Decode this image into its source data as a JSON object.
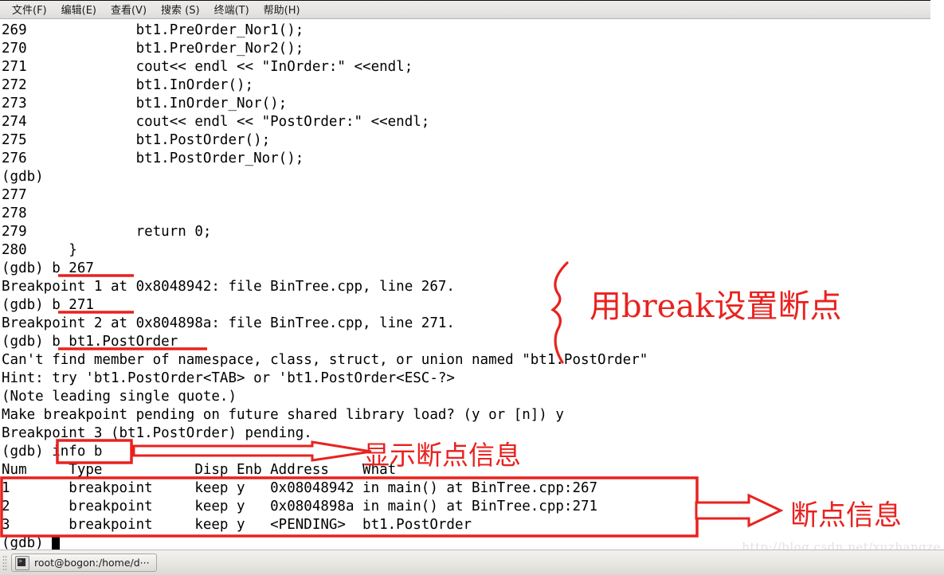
{
  "menubar": {
    "items": [
      {
        "label": "文件(F)",
        "name": "menu-file"
      },
      {
        "label": "编辑(E)",
        "name": "menu-edit"
      },
      {
        "label": "查看(V)",
        "name": "menu-view"
      },
      {
        "label": "搜索 (S)",
        "name": "menu-search"
      },
      {
        "label": "终端(T)",
        "name": "menu-terminal"
      },
      {
        "label": "帮助(H)",
        "name": "menu-help"
      }
    ]
  },
  "terminal": {
    "lines": [
      "269             bt1.PreOrder_Nor1();",
      "270             bt1.PreOrder_Nor2();",
      "271             cout<< endl << \"InOrder:\" <<endl;",
      "272             bt1.InOrder();",
      "273             bt1.InOrder_Nor();",
      "274             cout<< endl << \"PostOrder:\" <<endl;",
      "275             bt1.PostOrder();",
      "276             bt1.PostOrder_Nor();",
      "(gdb) ",
      "277",
      "278",
      "279             return 0;",
      "280     }",
      "(gdb) b 267",
      "Breakpoint 1 at 0x8048942: file BinTree.cpp, line 267.",
      "(gdb) b 271",
      "Breakpoint 2 at 0x804898a: file BinTree.cpp, line 271.",
      "(gdb) b bt1.PostOrder",
      "Can't find member of namespace, class, struct, or union named \"bt1.PostOrder\"",
      "Hint: try 'bt1.PostOrder<TAB> or 'bt1.PostOrder<ESC-?>",
      "(Note leading single quote.)",
      "Make breakpoint pending on future shared library load? (y or [n]) y",
      "Breakpoint 3 (bt1.PostOrder) pending.",
      "(gdb) info b",
      "Num     Type           Disp Enb Address    What",
      "1       breakpoint     keep y   0x08048942 in main() at BinTree.cpp:267",
      "2       breakpoint     keep y   0x0804898a in main() at BinTree.cpp:271",
      "3       breakpoint     keep y   <PENDING>  bt1.PostOrder",
      "(gdb) "
    ],
    "prompt": "(gdb)",
    "commands": [
      "b 267",
      "b 271",
      "b bt1.PostOrder",
      "info b"
    ],
    "breakpoint_table": {
      "headers": [
        "Num",
        "Type",
        "Disp",
        "Enb",
        "Address",
        "What"
      ],
      "rows": [
        [
          "1",
          "breakpoint",
          "keep",
          "y",
          "0x08048942",
          "in main() at BinTree.cpp:267"
        ],
        [
          "2",
          "breakpoint",
          "keep",
          "y",
          "0x0804898a",
          "in main() at BinTree.cpp:271"
        ],
        [
          "3",
          "breakpoint",
          "keep",
          "y",
          "<PENDING>",
          "bt1.PostOrder"
        ]
      ]
    }
  },
  "annotations": {
    "accent_color": "#e8221f",
    "note_break": "用break设置断点",
    "note_info": "显示断点信息",
    "note_table": "断点信息"
  },
  "taskbar": {
    "window_label": "root@bogon:/home/d···"
  },
  "watermark": {
    "text": "http://blog.csdn.net/xuzhangze"
  }
}
